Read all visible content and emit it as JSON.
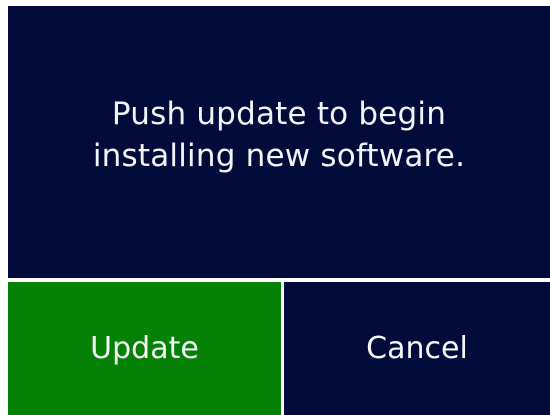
{
  "dialog": {
    "message_line_1": "Push update to begin",
    "message_line_2": "installing new software."
  },
  "buttons": {
    "update_label": "Update",
    "cancel_label": "Cancel"
  },
  "colors": {
    "panel_background": "#020b3a",
    "update_background": "#058205",
    "text": "#f2f3f7",
    "divider": "#ffffff"
  }
}
